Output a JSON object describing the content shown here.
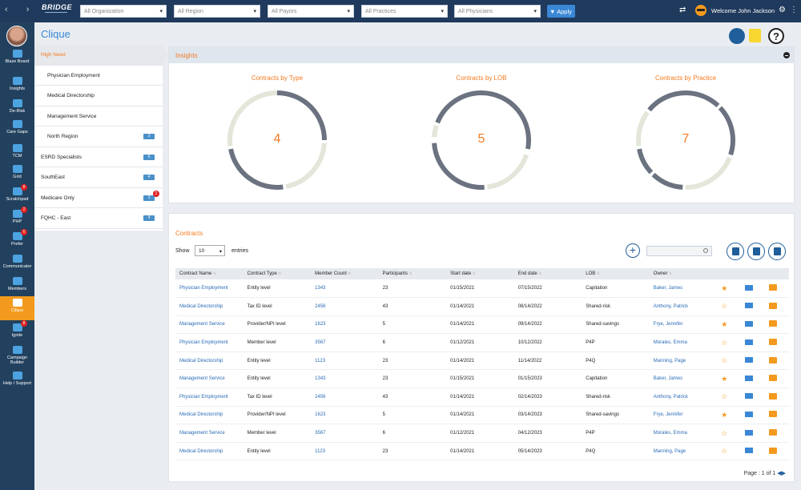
{
  "topbar": {
    "logo": "BRIDGE",
    "filters": [
      "All Organization",
      "All Region",
      "All Payors",
      "All Practices",
      "All Physicians"
    ],
    "apply_label": "Apply",
    "welcome": "Welcome John Jackson"
  },
  "sidebar": [
    {
      "label": "Blaze Board",
      "icon": "blaze-icon"
    },
    {
      "label": "Insights",
      "icon": "chart-icon"
    },
    {
      "label": "De-Risk",
      "icon": "shield-icon"
    },
    {
      "label": "Care Gaps",
      "icon": "heart-icon"
    },
    {
      "label": "TCM",
      "icon": "arrow-icon"
    },
    {
      "label": "Grid",
      "icon": "grid-icon"
    },
    {
      "label": "Scratchpad",
      "icon": "notepad-icon",
      "badge": "8"
    },
    {
      "label": "PHP",
      "icon": "phone-icon",
      "badge": "2"
    },
    {
      "label": "Prefer",
      "icon": "prefer-icon",
      "badge": "6"
    },
    {
      "label": "Communicator",
      "icon": "communicator-icon"
    },
    {
      "label": "Members",
      "icon": "members-icon"
    },
    {
      "label": "Clique",
      "icon": "group-icon",
      "active": true
    },
    {
      "label": "Ignite",
      "icon": "ignite-icon",
      "badge": "8"
    },
    {
      "label": "Campaign Builder",
      "icon": "megaphone-icon"
    },
    {
      "label": "Help / Support",
      "icon": "help-icon"
    }
  ],
  "page": {
    "title": "Clique"
  },
  "groups": [
    {
      "label": "High Need",
      "active": true
    },
    {
      "label": "Physician Employment",
      "sub": true
    },
    {
      "label": "Medical Directorship",
      "sub": true
    },
    {
      "label": "Management Service",
      "sub": true
    },
    {
      "label": "North Region",
      "sub": true,
      "count": "3"
    },
    {
      "label": "ESRD Specialists",
      "count": "6"
    },
    {
      "label": "SouthEast",
      "count": "4"
    },
    {
      "label": "Medicare Only",
      "count": "3",
      "badge": "2"
    },
    {
      "label": "FQHC - East",
      "count": "4"
    }
  ],
  "insights": {
    "title": "Insights",
    "charts": [
      {
        "title": "Contracts by Type",
        "value": "4"
      },
      {
        "title": "Contracts by LOB",
        "value": "5"
      },
      {
        "title": "Contracts by Practice",
        "value": "7"
      }
    ]
  },
  "contracts": {
    "title": "Contracts",
    "show_label": "Show",
    "entries_value": "10",
    "entries_label": "entries",
    "columns": [
      "Contract Name",
      "Contract Type",
      "Member Count",
      "Participants",
      "Start date",
      "End date",
      "LOB",
      "Owner"
    ],
    "rows": [
      [
        "Physician Employment",
        "Entity level",
        "1343",
        "23",
        "01/15/2021",
        "07/15/2022",
        "Capitation",
        "Baker, James"
      ],
      [
        "Medical Directorship",
        "Tax ID level",
        "2456",
        "43",
        "01/14/2021",
        "08/14/2022",
        "Shared-risk",
        "Anthony, Patrick"
      ],
      [
        "Management Service",
        "Provider/NPI level",
        "1623",
        "5",
        "01/14/2021",
        "09/14/2022",
        "Shared-savings",
        "Frye, Jennifer"
      ],
      [
        "Physician Employment",
        "Member level",
        "3567",
        "6",
        "01/12/2021",
        "10/12/2022",
        "P4P",
        "Morales, Emma"
      ],
      [
        "Medical Directorship",
        "Entity level",
        "1123",
        "23",
        "01/14/2021",
        "11/14/2022",
        "P4Q",
        "Manning, Page"
      ],
      [
        "Management Service",
        "Entity level",
        "1343",
        "23",
        "01/15/2021",
        "01/15/2023",
        "Capitation",
        "Baker, James"
      ],
      [
        "Physician Employment",
        "Tax ID level",
        "2456",
        "43",
        "01/14/2021",
        "02/14/2023",
        "Shared-risk",
        "Anthony, Patrick"
      ],
      [
        "Medical Directorship",
        "Provider/NPI level",
        "1623",
        "5",
        "01/14/2021",
        "03/14/2023",
        "Shared-savings",
        "Frye, Jennifer"
      ],
      [
        "Management Service",
        "Member level",
        "3567",
        "6",
        "01/12/2021",
        "04/12/2023",
        "P4P",
        "Morales, Emma"
      ],
      [
        "Medical Directorship",
        "Entity level",
        "1123",
        "23",
        "01/14/2021",
        "05/14/2023",
        "P4Q",
        "Manning, Page"
      ]
    ],
    "starred": [
      true,
      false,
      true,
      false,
      false,
      true,
      false,
      true,
      false,
      false
    ],
    "pager": "Page : 1 of 1"
  }
}
